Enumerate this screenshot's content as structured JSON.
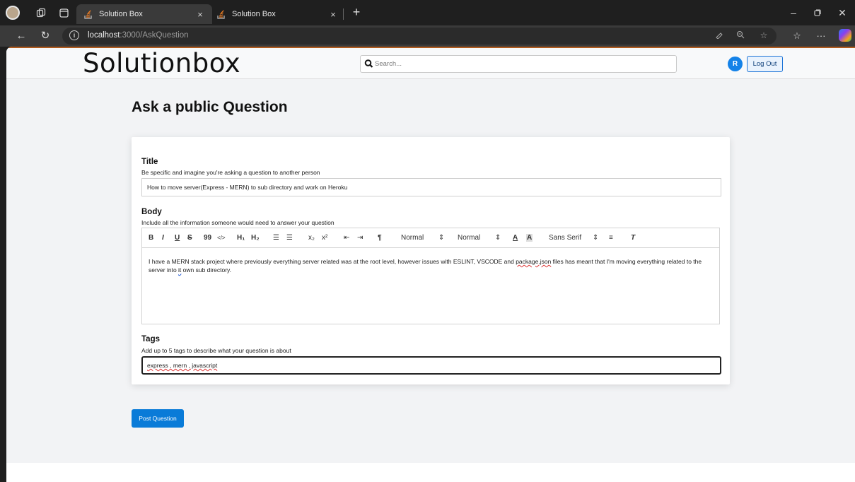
{
  "browser": {
    "tabs": [
      {
        "title": "Solution Box",
        "active": true
      },
      {
        "title": "Solution Box",
        "active": false
      }
    ],
    "new_tab_icon": "+",
    "close_icon": "×",
    "url_host": "localhost",
    "url_rest": ":3000/AskQuestion"
  },
  "site": {
    "logo": "Solutionbox",
    "search_placeholder": "Search...",
    "avatar_initial": "R",
    "logout_label": "Log Out"
  },
  "page": {
    "title": "Ask a public Question",
    "title_field": {
      "label": "Title",
      "hint": "Be specific and imagine you're asking a question to another person",
      "value": "How to move server(Express - MERN) to sub directory and work on Heroku"
    },
    "body_field": {
      "label": "Body",
      "hint": "Include all the information someone would need to answer your question",
      "toolbar": {
        "header1": "H₁",
        "header2": "H₂",
        "subscript": "x₂",
        "superscript": "x²",
        "size_select": "Normal",
        "header_select": "Normal",
        "font_select": "Sans Serif"
      },
      "content_part1": "I have a MERN stack project where previously everything server related was at the root level, however issues with ESLINT, VSCODE and ",
      "content_word1": "package.json",
      "content_part2": " files has meant that I'm moving everything related to the server into ",
      "content_word2": "it",
      "content_part3": " own sub directory."
    },
    "tags_field": {
      "label": "Tags",
      "hint": "Add up to 5 tags to describe what your question is about",
      "value": "express , mern , javascript"
    },
    "post_button": "Post Question"
  },
  "colors": {
    "accent": "#0a7bd8",
    "tab_active": "#3a3a3a",
    "chrome": "#1f1f1f"
  }
}
